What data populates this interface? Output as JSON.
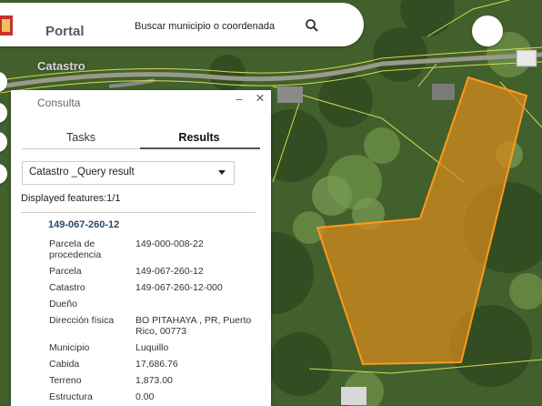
{
  "header": {
    "title": "Portal",
    "search_text": "Buscar municipio o coordenada"
  },
  "map": {
    "layer_label": "Catastro",
    "parcel_color": "#f5a623"
  },
  "panel": {
    "title": "Consulta",
    "tabs": [
      "Tasks",
      "Results"
    ],
    "active_tab": "Results",
    "dropdown_value": "Catastro _Query result",
    "displayed_label": "Displayed features:",
    "displayed_count": "1/1",
    "feature_id": "149-067-260-12",
    "attributes": [
      {
        "label": "Parcela de procedencia",
        "value": "149-000-008-22"
      },
      {
        "label": "Parcela",
        "value": "149-067-260-12"
      },
      {
        "label": "Catastro",
        "value": "149-067-260-12-000"
      },
      {
        "label": "Dueño",
        "value": ""
      },
      {
        "label": "Dirección física",
        "value": "BO PITAHAYA , PR, Puerto Rico, 00773"
      },
      {
        "label": "Municipio",
        "value": "Luquillo"
      },
      {
        "label": "Cabida",
        "value": "17,686.76"
      },
      {
        "label": "Terreno",
        "value": "1,873.00"
      },
      {
        "label": "Estructura",
        "value": "0.00"
      }
    ]
  }
}
